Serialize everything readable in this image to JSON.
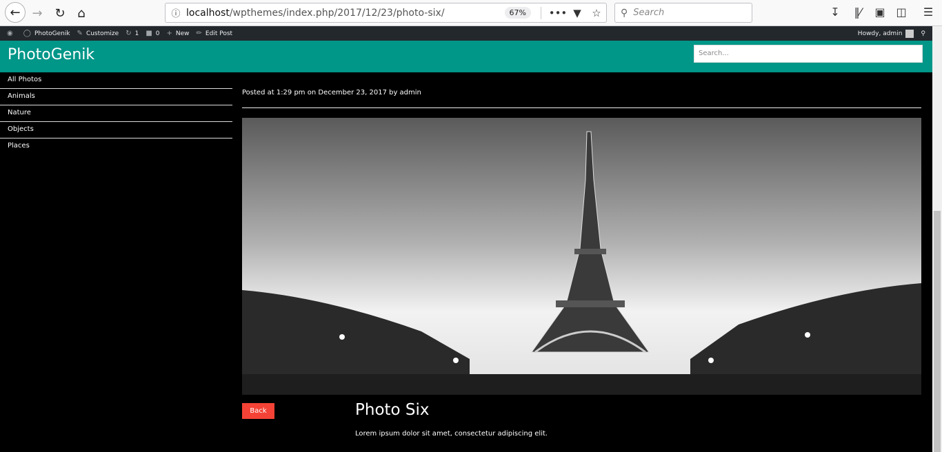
{
  "browser": {
    "url_host": "localhost",
    "url_path": "/wpthemes/index.php/2017/12/23/photo-six/",
    "zoom": "67%",
    "search_placeholder": "Search"
  },
  "adminbar": {
    "site_name": "PhotoGenik",
    "customize": "Customize",
    "updates": "1",
    "comments": "0",
    "new": "New",
    "edit_post": "Edit Post",
    "howdy": "Howdy, admin"
  },
  "header": {
    "title": "PhotoGenik",
    "search_placeholder": "Search..."
  },
  "sidebar": {
    "items": [
      {
        "label": "All Photos"
      },
      {
        "label": "Animals"
      },
      {
        "label": "Nature"
      },
      {
        "label": "Objects"
      },
      {
        "label": "Places"
      }
    ]
  },
  "post": {
    "meta": "Posted at 1:29 pm on December 23, 2017 by admin",
    "back_label": "Back",
    "title": "Photo Six",
    "body": "Lorem ipsum dolor sit amet, consectetur adipiscing elit."
  }
}
